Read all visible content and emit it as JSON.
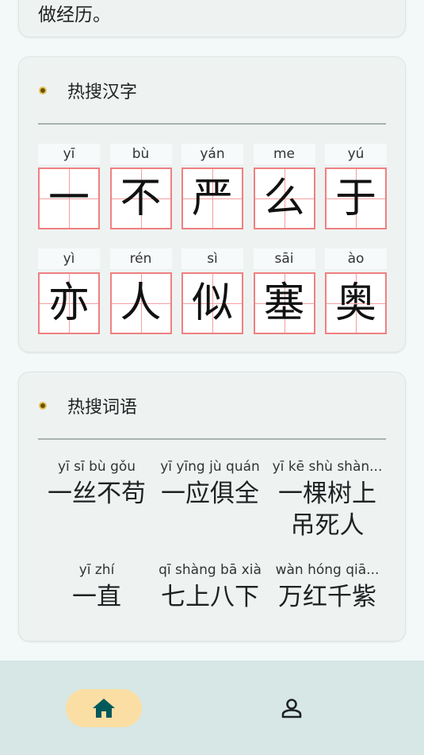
{
  "top_card": {
    "text": "做经历。"
  },
  "hot_chars": {
    "title": "热搜汉字",
    "rows": [
      [
        {
          "pinyin": "yī",
          "char": "一"
        },
        {
          "pinyin": "bù",
          "char": "不"
        },
        {
          "pinyin": "yán",
          "char": "严"
        },
        {
          "pinyin": "me",
          "char": "么"
        },
        {
          "pinyin": "yú",
          "char": "于"
        }
      ],
      [
        {
          "pinyin": "yì",
          "char": "亦"
        },
        {
          "pinyin": "rén",
          "char": "人"
        },
        {
          "pinyin": "sì",
          "char": "似"
        },
        {
          "pinyin": "sāi",
          "char": "塞"
        },
        {
          "pinyin": "ào",
          "char": "奥"
        }
      ]
    ]
  },
  "hot_words": {
    "title": "热搜词语",
    "items": [
      {
        "pinyin": "yī sī bù gǒu",
        "word": "一丝不苟"
      },
      {
        "pinyin": "yī yīng jù quán",
        "word": "一应俱全"
      },
      {
        "pinyin": "yī kē shù shàn...",
        "word": "一棵树上吊死人"
      },
      {
        "pinyin": "yī zhí",
        "word": "一直"
      },
      {
        "pinyin": "qī shàng bā xià",
        "word": "七上八下"
      },
      {
        "pinyin": "wàn hóng qiā...",
        "word": "万红千紫"
      }
    ]
  },
  "nav": {
    "items": [
      {
        "name": "home",
        "icon": "home-icon",
        "active": true
      },
      {
        "name": "profile",
        "icon": "person-icon",
        "active": false
      }
    ],
    "active_color": "#fbdea3",
    "icon_color": "#00585a"
  }
}
